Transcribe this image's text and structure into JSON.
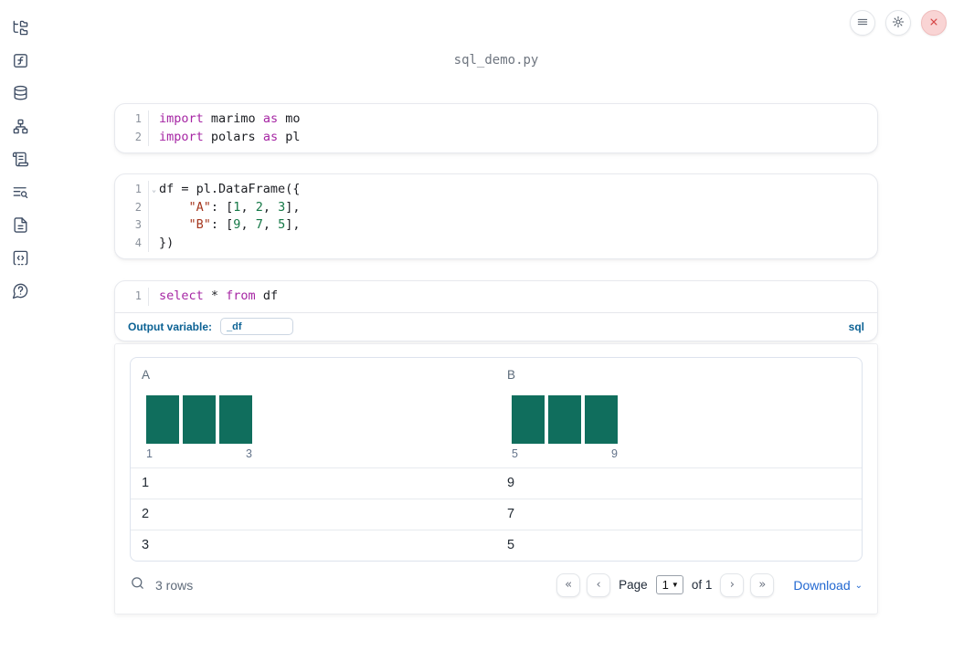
{
  "app": {
    "title": "sql_demo.py"
  },
  "topbar": {
    "buttons": [
      {
        "icon": "menu-icon"
      },
      {
        "icon": "gear-icon"
      },
      {
        "icon": "close-icon"
      }
    ]
  },
  "sidebar": {
    "items": [
      {
        "icon": "file-tree-icon"
      },
      {
        "icon": "function-icon"
      },
      {
        "icon": "database-icon"
      },
      {
        "icon": "network-icon"
      },
      {
        "icon": "scroll-icon"
      },
      {
        "icon": "list-search-icon"
      },
      {
        "icon": "document-icon"
      },
      {
        "icon": "code-snippet-icon"
      },
      {
        "icon": "help-icon"
      }
    ]
  },
  "cells": [
    {
      "type": "python",
      "lines": [
        {
          "n": "1",
          "t": [
            [
              "k",
              "import"
            ],
            [
              "p",
              " marimo "
            ],
            [
              "k",
              "as"
            ],
            [
              "p",
              " mo"
            ]
          ]
        },
        {
          "n": "2",
          "t": [
            [
              "k",
              "import"
            ],
            [
              "p",
              " polars "
            ],
            [
              "k",
              "as"
            ],
            [
              "p",
              " pl"
            ]
          ]
        }
      ]
    },
    {
      "type": "python",
      "lines": [
        {
          "n": "1",
          "fold": "⌄",
          "t": [
            [
              "p",
              "df = pl.DataFrame({"
            ]
          ]
        },
        {
          "n": "2",
          "t": [
            [
              "p",
              "    "
            ],
            [
              "s",
              "\"A\""
            ],
            [
              "p",
              ": ["
            ],
            [
              "num",
              "1"
            ],
            [
              "p",
              ", "
            ],
            [
              "num",
              "2"
            ],
            [
              "p",
              ", "
            ],
            [
              "num",
              "3"
            ],
            [
              "p",
              "],"
            ]
          ]
        },
        {
          "n": "3",
          "t": [
            [
              "p",
              "    "
            ],
            [
              "s",
              "\"B\""
            ],
            [
              "p",
              ": ["
            ],
            [
              "num",
              "9"
            ],
            [
              "p",
              ", "
            ],
            [
              "num",
              "7"
            ],
            [
              "p",
              ", "
            ],
            [
              "num",
              "5"
            ],
            [
              "p",
              "],"
            ]
          ]
        },
        {
          "n": "4",
          "t": [
            [
              "p",
              "})"
            ]
          ]
        }
      ]
    },
    {
      "type": "sql",
      "lines": [
        {
          "n": "1",
          "t": [
            [
              "k",
              "select"
            ],
            [
              "p",
              " * "
            ],
            [
              "k",
              "from"
            ],
            [
              "p",
              " df"
            ]
          ]
        }
      ],
      "output_variable_label": "Output variable:",
      "output_variable_value": "_df",
      "language_label": "sql"
    }
  ],
  "table": {
    "columns": [
      {
        "name": "A"
      },
      {
        "name": "B"
      }
    ],
    "rows": [
      [
        "1",
        "9"
      ],
      [
        "2",
        "7"
      ],
      [
        "3",
        "5"
      ]
    ],
    "row_count_label": "3 rows",
    "pagination": {
      "first": "«",
      "prev": "‹",
      "next": "›",
      "last": "»",
      "page_label": "Page",
      "page_value": "1",
      "of_label": "of 1"
    },
    "download_label": "Download"
  },
  "chart_data": [
    {
      "type": "bar",
      "title": "Column A value histogram",
      "values": [
        1,
        1,
        1
      ],
      "tick_labels": [
        "1",
        "3"
      ],
      "xlabel": "",
      "ylabel": "",
      "ylim": [
        0,
        1
      ],
      "grid": false,
      "legend": false
    },
    {
      "type": "bar",
      "title": "Column B value histogram",
      "values": [
        1,
        1,
        1
      ],
      "tick_labels": [
        "5",
        "9"
      ],
      "xlabel": "",
      "ylabel": "",
      "ylim": [
        0,
        1
      ],
      "grid": false,
      "legend": false
    }
  ],
  "colors": {
    "accent_blue": "#0c6294",
    "link_blue": "#2268d1",
    "histogram_bar": "#106e5d",
    "keyword_purple": "#a626a4",
    "string_red": "#a5371e",
    "number_green": "#147846",
    "close_red": "#d64545"
  }
}
